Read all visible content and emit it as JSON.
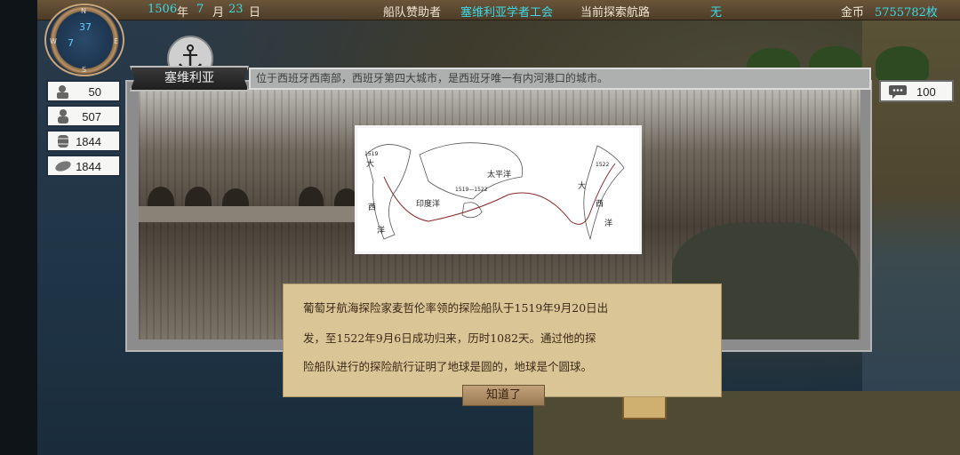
{
  "topbar": {
    "year": "1506",
    "year_unit": "年",
    "month": "7",
    "month_unit": "月",
    "day": "23",
    "day_unit": "日",
    "sponsor_label": "船队赞助者",
    "sponsor_value": "塞维利亚学者工会",
    "route_label": "当前探索航路",
    "route_value": "无",
    "gold_label": "金币",
    "gold_value": "5755782枚"
  },
  "compass": {
    "n": "N",
    "e": "E",
    "s": "S",
    "w": "W",
    "top_num": "37",
    "left_num": "7"
  },
  "stats": [
    {
      "icon": "sailor-icon",
      "value": "50"
    },
    {
      "icon": "crew-icon",
      "value": "507"
    },
    {
      "icon": "barrel-icon",
      "value": "1844"
    },
    {
      "icon": "food-icon",
      "value": "1844"
    }
  ],
  "messages": {
    "icon": "chat-icon",
    "value": "100"
  },
  "city": {
    "name": "塞维利亚",
    "description": "位于西班牙西南部，西班牙第四大城市，是西班牙唯一有内河港口的城市。"
  },
  "map_image": {
    "labels": [
      "大",
      "西",
      "洋",
      "太平洋",
      "印度洋",
      "大",
      "西",
      "洋",
      "1519",
      "1522",
      "1519—1522"
    ]
  },
  "dialog": {
    "line1": "葡萄牙航海探险家麦哲伦率领的探险船队于1519年9月20日出",
    "line2": "发，至1522年9月6日成功归来，历时1082天。通过他的探",
    "line3": "险船队进行的探险航行证明了地球是圆的，地球是个圆球。",
    "ok_label": "知道了"
  },
  "colors": {
    "accent_cyan": "#3fd9e6",
    "dialog_bg": "#d9c596",
    "button_bg": "#b08e64"
  }
}
